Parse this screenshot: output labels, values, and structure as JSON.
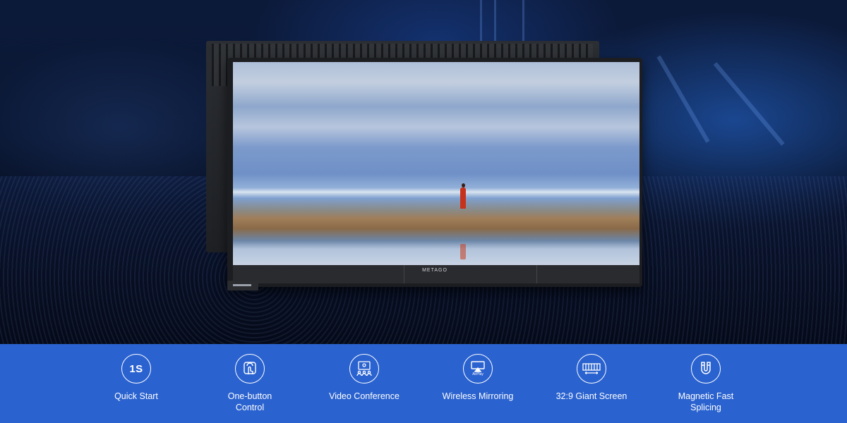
{
  "monitor": {
    "brand": "METAGO"
  },
  "features": [
    {
      "icon": "1s-icon",
      "icon_text": "1S",
      "label": "Quick Start"
    },
    {
      "icon": "touch-icon",
      "label": "One-button\nControl"
    },
    {
      "icon": "video-conference-icon",
      "label": "Video Conference"
    },
    {
      "icon": "airplay-icon",
      "icon_text": "AirPlay",
      "label": "Wireless Mirroring"
    },
    {
      "icon": "giant-screen-icon",
      "label": "32:9 Giant Screen"
    },
    {
      "icon": "magnet-icon",
      "label": "Magnetic Fast\nSplicing"
    }
  ],
  "colors": {
    "bar": "#2a62cf",
    "background": "#070f22"
  }
}
